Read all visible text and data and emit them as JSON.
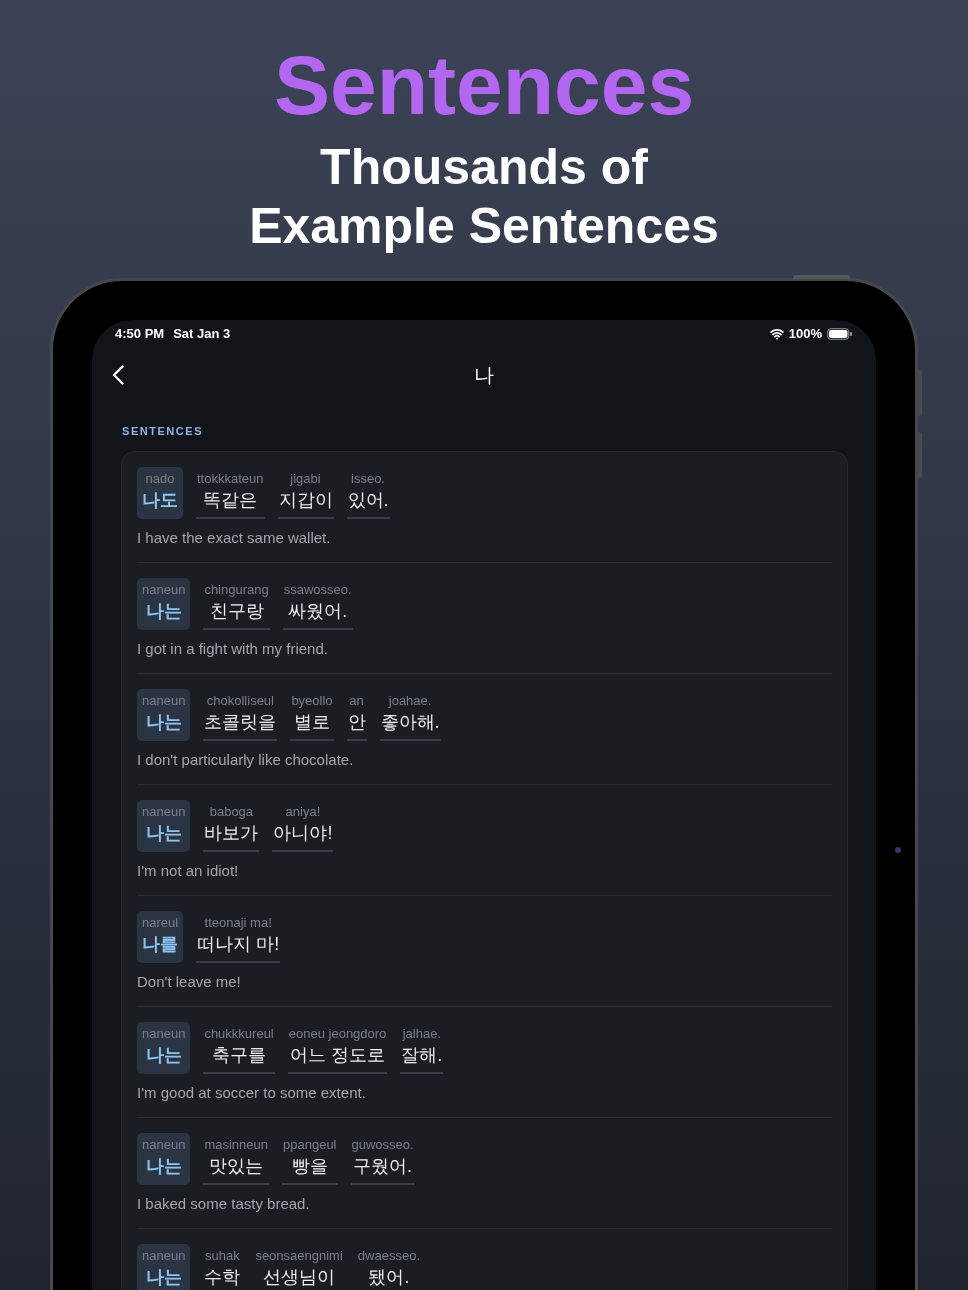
{
  "header": {
    "title": "Sentences",
    "subtitle_lines": [
      "Thousands of",
      "Example Sentences"
    ]
  },
  "status_bar": {
    "time": "4:50 PM",
    "date": "Sat Jan 3",
    "battery": "100%"
  },
  "nav": {
    "title": "나"
  },
  "section": {
    "label": "SENTENCES"
  },
  "sentences": [
    {
      "words": [
        {
          "romanization": "nado",
          "korean": "나도",
          "highlighted": true
        },
        {
          "romanization": "ttokkkateun",
          "korean": "똑같은",
          "highlighted": false
        },
        {
          "romanization": "jigabi",
          "korean": "지갑이",
          "highlighted": false
        },
        {
          "romanization": "isseo.",
          "korean": "있어.",
          "highlighted": false
        }
      ],
      "translation": "I have the exact same wallet."
    },
    {
      "words": [
        {
          "romanization": "naneun",
          "korean": "나는",
          "highlighted": true
        },
        {
          "romanization": "chingurang",
          "korean": "친구랑",
          "highlighted": false
        },
        {
          "romanization": "ssawosseo.",
          "korean": "싸웠어.",
          "highlighted": false
        }
      ],
      "translation": "I got in a fight with my friend."
    },
    {
      "words": [
        {
          "romanization": "naneun",
          "korean": "나는",
          "highlighted": true
        },
        {
          "romanization": "chokolliseul",
          "korean": "초콜릿을",
          "highlighted": false
        },
        {
          "romanization": "byeollo",
          "korean": "별로",
          "highlighted": false
        },
        {
          "romanization": "an",
          "korean": "안",
          "highlighted": false
        },
        {
          "romanization": "joahae.",
          "korean": "좋아해.",
          "highlighted": false
        }
      ],
      "translation": "I don't particularly like chocolate."
    },
    {
      "words": [
        {
          "romanization": "naneun",
          "korean": "나는",
          "highlighted": true
        },
        {
          "romanization": "baboga",
          "korean": "바보가",
          "highlighted": false
        },
        {
          "romanization": "aniya!",
          "korean": "아니야!",
          "highlighted": false
        }
      ],
      "translation": "I'm not an idiot!"
    },
    {
      "words": [
        {
          "romanization": "nareul",
          "korean": "나를",
          "highlighted": true
        },
        {
          "romanization": "tteonaji ma!",
          "korean": "떠나지 마!",
          "highlighted": false
        }
      ],
      "translation": "Don't leave me!"
    },
    {
      "words": [
        {
          "romanization": "naneun",
          "korean": "나는",
          "highlighted": true
        },
        {
          "romanization": "chukkkureul",
          "korean": "축구를",
          "highlighted": false
        },
        {
          "romanization": "eoneu jeongdoro",
          "korean": "어느 정도로",
          "highlighted": false
        },
        {
          "romanization": "jalhae.",
          "korean": "잘해.",
          "highlighted": false
        }
      ],
      "translation": "I'm good at soccer to some extent."
    },
    {
      "words": [
        {
          "romanization": "naneun",
          "korean": "나는",
          "highlighted": true
        },
        {
          "romanization": "masinneun",
          "korean": "맛있는",
          "highlighted": false
        },
        {
          "romanization": "ppangeul",
          "korean": "빵을",
          "highlighted": false
        },
        {
          "romanization": "guwosseo.",
          "korean": "구웠어.",
          "highlighted": false
        }
      ],
      "translation": "I baked some tasty bread."
    },
    {
      "words": [
        {
          "romanization": "naneun",
          "korean": "나는",
          "highlighted": true
        },
        {
          "romanization": "suhak",
          "korean": "수학",
          "highlighted": false
        },
        {
          "romanization": "seonsaengnimi",
          "korean": "선생님이",
          "highlighted": false
        },
        {
          "romanization": "dwaesseo.",
          "korean": "됐어.",
          "highlighted": false
        }
      ]
    }
  ]
}
